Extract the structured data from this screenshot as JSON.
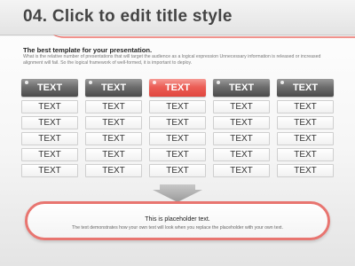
{
  "slide": {
    "title": "04.  Click to edit title style",
    "subtitle": "The best template for your presentation.",
    "body_text": "What is the relative number of presentations that will target the audience as a logical expression Unnecessary information is released or increased alignment will fail. So the logical framework of well-formed, it is important to deploy.",
    "accent_color": "#e8524a",
    "header_dark_color": "#5a5a5a"
  },
  "table": {
    "columns": [
      {
        "header": "TEXT",
        "highlight": false,
        "cells": [
          "TEXT",
          "TEXT",
          "TEXT",
          "TEXT",
          "TEXT"
        ]
      },
      {
        "header": "TEXT",
        "highlight": false,
        "cells": [
          "TEXT",
          "TEXT",
          "TEXT",
          "TEXT",
          "TEXT"
        ]
      },
      {
        "header": "TEXT",
        "highlight": true,
        "cells": [
          "TEXT",
          "TEXT",
          "TEXT",
          "TEXT",
          "TEXT"
        ]
      },
      {
        "header": "TEXT",
        "highlight": false,
        "cells": [
          "TEXT",
          "TEXT",
          "TEXT",
          "TEXT",
          "TEXT"
        ]
      },
      {
        "header": "TEXT",
        "highlight": false,
        "cells": [
          "TEXT",
          "TEXT",
          "TEXT",
          "TEXT",
          "TEXT"
        ]
      }
    ]
  },
  "callout": {
    "title": "This is placeholder text.",
    "text": "The text demonstrates how your own text will look when you replace the placeholder with your own text."
  },
  "icons": {
    "arrow": "down-arrow-icon"
  }
}
